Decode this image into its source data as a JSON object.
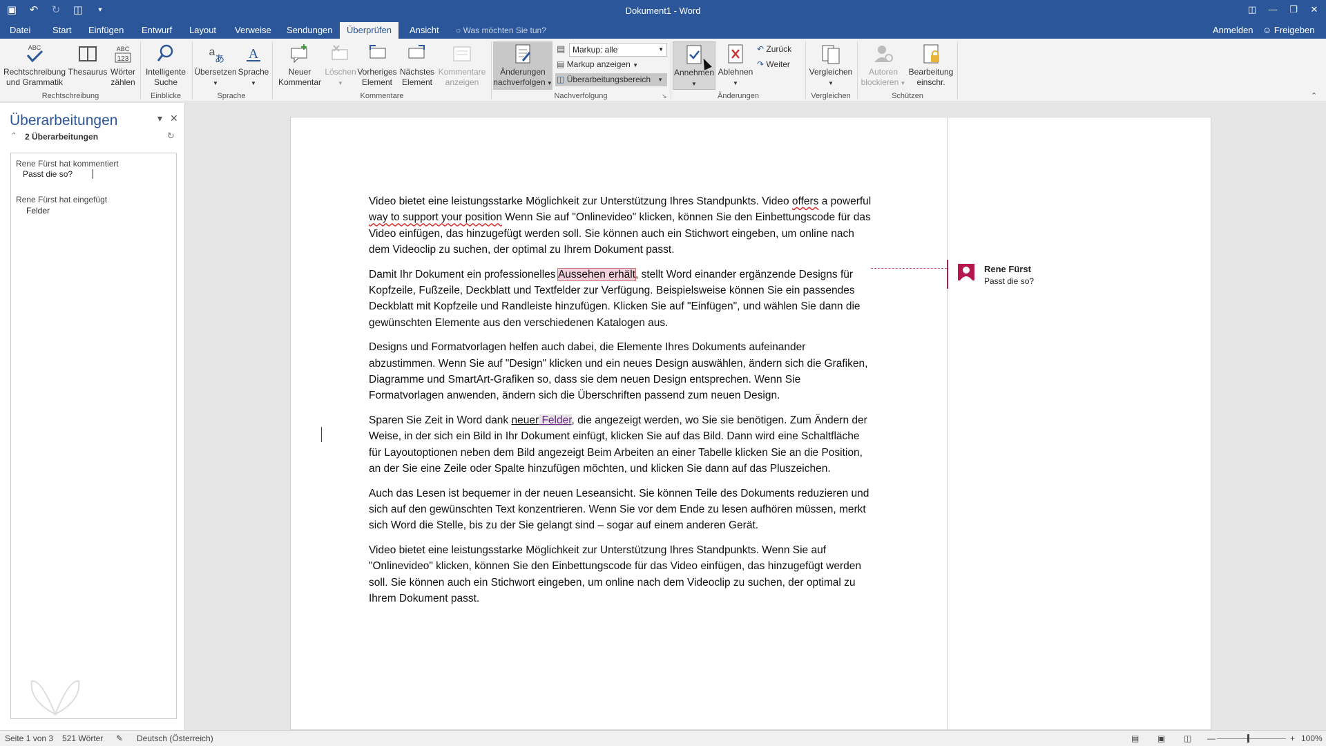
{
  "window": {
    "title": "Dokument1 - Word",
    "qat": [
      "save-icon",
      "undo-icon",
      "redo-icon",
      "new-doc-icon",
      "customize-icon"
    ],
    "controls": [
      "ribbon-display-icon",
      "minimize-icon",
      "restore-icon",
      "close-icon"
    ]
  },
  "tabs": [
    {
      "label": "Datei"
    },
    {
      "label": "Start"
    },
    {
      "label": "Einfügen"
    },
    {
      "label": "Entwurf"
    },
    {
      "label": "Layout"
    },
    {
      "label": "Verweise"
    },
    {
      "label": "Sendungen"
    },
    {
      "label": "Überprüfen",
      "active": true
    },
    {
      "label": "Ansicht"
    }
  ],
  "tellme": "Was möchten Sie tun?",
  "account": {
    "signin": "Anmelden",
    "share": "Freigeben"
  },
  "ribbon": {
    "rechtschreibung": {
      "label": "Rechtschreibung und Grammatik",
      "line1": "Rechtschreibung",
      "line2": "und Grammatik"
    },
    "thesaurus": {
      "label": "Thesaurus"
    },
    "woerter": {
      "line1": "Wörter",
      "line2": "zählen"
    },
    "suche": {
      "line1": "Intelligente",
      "line2": "Suche"
    },
    "uebersetzen": {
      "label": "Übersetzen"
    },
    "sprache": {
      "label": "Sprache"
    },
    "neuer_kommentar": {
      "line1": "Neuer",
      "line2": "Kommentar"
    },
    "loeschen": {
      "label": "Löschen"
    },
    "vorheriges": {
      "line1": "Vorheriges",
      "line2": "Element"
    },
    "naechstes": {
      "line1": "Nächstes",
      "line2": "Element"
    },
    "kommentare_anzeigen": {
      "line1": "Kommentare",
      "line2": "anzeigen"
    },
    "aenderungen": {
      "line1": "Änderungen",
      "line2": "nachverfolgen"
    },
    "markup_dropdown": "Markup: alle",
    "markup_anzeigen": "Markup anzeigen",
    "ueberarbeitungsbereich": "Überarbeitungsbereich",
    "annehmen": {
      "label": "Annehmen"
    },
    "ablehnen": {
      "label": "Ablehnen"
    },
    "zurueck": "Zurück",
    "weiter": "Weiter",
    "vergleichen": {
      "label": "Vergleichen"
    },
    "autoren": {
      "line1": "Autoren",
      "line2": "blockieren"
    },
    "bearbeitung": {
      "line1": "Bearbeitung",
      "line2": "einschr."
    },
    "groups": {
      "rechtschreibung": "Rechtschreibung",
      "einblicke": "Einblicke",
      "sprache": "Sprache",
      "kommentare": "Kommentare",
      "nachverfolgung": "Nachverfolgung",
      "aenderungen": "Änderungen",
      "vergleichen": "Vergleichen",
      "schuetzen": "Schützen"
    }
  },
  "revisions_pane": {
    "title": "Überarbeitungen",
    "count": "2 Überarbeitungen",
    "items": [
      {
        "author_action": "Rene Fürst hat kommentiert",
        "detail": "Passt die so?"
      },
      {
        "author_action": "Rene Fürst hat eingefügt",
        "detail": "Felder"
      }
    ]
  },
  "document": {
    "p1": {
      "a": "Video bietet eine leistungsstarke Möglichkeit zur Unterstützung Ihres Standpunkts. Video ",
      "sq1": "offers",
      "b": " a powerful ",
      "sq2": "way to support your position",
      "c": " Wenn Sie auf \"Onlinevideo\" klicken, können Sie den Einbettungscode für das Video einfügen, das hinzugefügt werden soll. Sie können auch ein Stichwort eingeben, um online nach dem Videoclip zu suchen, der optimal zu Ihrem Dokument passt."
    },
    "p2": {
      "a": "Damit Ihr Dokument ein professionelles ",
      "commented": "Aussehen erhält",
      "b": ", stellt Word einander ergänzende Designs für Kopfzeile, Fußzeile, Deckblatt und Textfelder zur Verfügung. Beispielsweise können Sie ein passendes Deckblatt mit Kopfzeile und Randleiste hinzufügen. Klicken Sie auf \"Einfügen\", und wählen Sie dann die gewünschten Elemente aus den verschiedenen Katalogen aus."
    },
    "p3": "Designs und Formatvorlagen helfen auch dabei, die Elemente Ihres Dokuments aufeinander abzustimmen. Wenn Sie auf \"Design\" klicken und ein neues Design auswählen, ändern sich die Grafiken, Diagramme und SmartArt-Grafiken so, dass sie dem neuen Design entsprechen. Wenn Sie Formatvorlagen anwenden, ändern sich die Überschriften passend zum neuen Design.",
    "p4": {
      "a": "Sparen Sie Zeit in Word dank ",
      "neuer": "neuer",
      "inserted": " Felder",
      "b": ", die angezeigt werden, wo Sie sie benötigen. Zum Ändern der Weise, in der sich ein Bild in Ihr Dokument einfügt, klicken Sie auf das Bild. Dann wird eine Schaltfläche für Layoutoptionen neben dem Bild angezeigt Beim Arbeiten an einer Tabelle klicken Sie an die Position, an der Sie eine Zeile oder Spalte hinzufügen möchten, und klicken Sie dann auf das Pluszeichen."
    },
    "p5": "Auch das Lesen ist bequemer in der neuen Leseansicht. Sie können Teile des Dokuments reduzieren und sich auf den gewünschten Text konzentrieren. Wenn Sie vor dem Ende zu lesen aufhören müssen, merkt sich Word die Stelle, bis zu der Sie gelangt sind – sogar auf einem anderen Gerät.",
    "p6": "Video bietet eine leistungsstarke Möglichkeit zur Unterstützung Ihres Standpunkts. Wenn Sie auf \"Onlinevideo\" klicken, können Sie den Einbettungscode für das Video einfügen, das hinzugefügt werden soll. Sie können auch ein Stichwort eingeben, um online nach dem Videoclip zu suchen, der optimal zu Ihrem Dokument passt."
  },
  "comment": {
    "author": "Rene Fürst",
    "text": "Passt die so?"
  },
  "status": {
    "page": "Seite 1 von 3",
    "words": "521 Wörter",
    "language": "Deutsch (Österreich)",
    "zoom": "100%",
    "zoom_level": 1.0
  },
  "colors": {
    "accent": "#2b579a",
    "comment": "#b5184f",
    "insertion": "#6b2b7f"
  }
}
